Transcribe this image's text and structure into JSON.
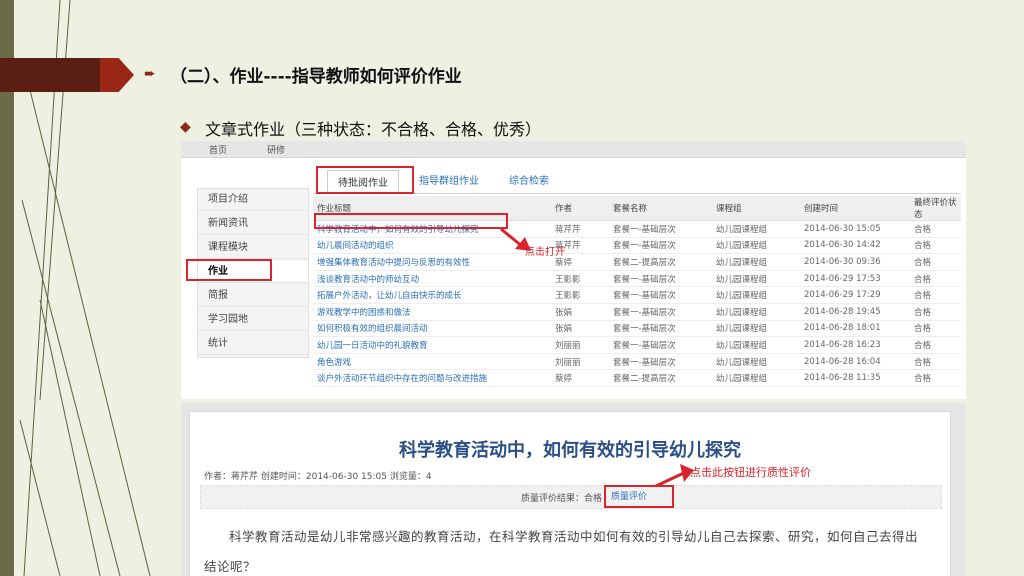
{
  "slide": {
    "heading": "（二）、作业----指导教师如何评价作业",
    "subheading": "文章式作业（三种状态：不合格、合格、优秀）",
    "bullet_square": "➨",
    "bullet_diamond": "◆"
  },
  "shot1": {
    "topnav": [
      "首页",
      "研修"
    ],
    "sidebar": [
      "项目介绍",
      "新闻资讯",
      "课程模块",
      "作业",
      "简报",
      "学习园地",
      "统计"
    ],
    "sidebar_active": "作业",
    "tabs": [
      "待批阅作业",
      "指导群组作业",
      "综合检索"
    ],
    "annotation": "点击打开",
    "columns": [
      "作业标题",
      "作者",
      "套餐名称",
      "课程组",
      "创建时间",
      "最终评价状态"
    ],
    "rows": [
      [
        "科学教育活动中，如何有效的引导幼儿探究",
        "蒋芹芹",
        "套餐一-基础层次",
        "幼儿园课程组",
        "2014-06-30 15:05",
        "合格"
      ],
      [
        "幼儿晨间活动的组织",
        "蒋芹芹",
        "套餐一-基础层次",
        "幼儿园课程组",
        "2014-06-30 14:42",
        "合格"
      ],
      [
        "增强集体教育活动中提问与反思的有效性",
        "蔡婷",
        "套餐二-提高层次",
        "幼儿园课程组",
        "2014-06-30 09:36",
        "合格"
      ],
      [
        "浅谈教育活动中的师幼互动",
        "王影影",
        "套餐一-基础层次",
        "幼儿园课程组",
        "2014-06-29 17:53",
        "合格"
      ],
      [
        "拓展户外活动，让幼儿自由快乐的成长",
        "王影影",
        "套餐一-基础层次",
        "幼儿园课程组",
        "2014-06-29 17:29",
        "合格"
      ],
      [
        "游戏教学中的困惑和做法",
        "张娟",
        "套餐一-基础层次",
        "幼儿园课程组",
        "2014-06-28 19:45",
        "合格"
      ],
      [
        "如何积极有效的组织晨间活动",
        "张娟",
        "套餐一-基础层次",
        "幼儿园课程组",
        "2014-06-28 18:01",
        "合格"
      ],
      [
        "幼儿园一日活动中的礼貌教育",
        "刘丽丽",
        "套餐一-基础层次",
        "幼儿园课程组",
        "2014-06-28 16:23",
        "合格"
      ],
      [
        "角色游戏",
        "刘丽丽",
        "套餐一-基础层次",
        "幼儿园课程组",
        "2014-06-28 16:04",
        "合格"
      ],
      [
        "谈户外活动环节组织中存在的问题与改进措施",
        "蔡婷",
        "套餐二-提高层次",
        "幼儿园课程组",
        "2014-06-28 11:35",
        "合格"
      ]
    ]
  },
  "shot2": {
    "article_title": "科学教育活动中，如何有效的引导幼儿探究",
    "meta": "作者：蒋芹芹 创建时间：2014-06-30 15:05 浏览量：4",
    "result_label": "质量评价结果：合格",
    "result_button": "质量评价",
    "annotation": "点击此按钮进行质性评价",
    "body": "科学教育活动是幼儿非常感兴趣的教育活动，在科学教育活动中如何有效的引导幼儿自己去探索、研究，如何自己去得出结论呢？"
  },
  "colors": {
    "accent_red": "#d9232d",
    "link_blue": "#2a6fb8",
    "banner_dark": "#5a1e12"
  }
}
